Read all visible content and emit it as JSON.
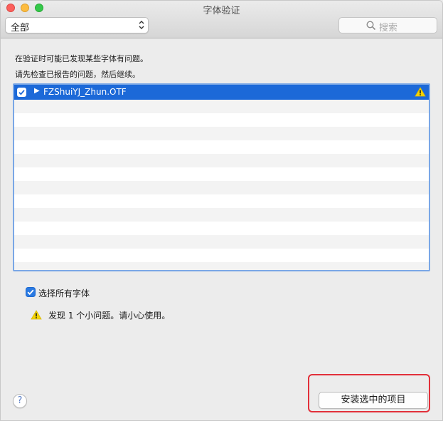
{
  "window": {
    "title": "字体验证"
  },
  "filter": {
    "selected": "全部",
    "arrows_icon": "chevron-up-down-icon"
  },
  "search": {
    "placeholder": "搜索",
    "icon": "search-icon"
  },
  "description": {
    "line1": "在验证时可能已发现某些字体有问题。",
    "line2": "请先检查已报告的问题，然后继续。"
  },
  "font_list": {
    "items": [
      {
        "name": "FZShuiYJ_Zhun.OTF",
        "checked": true,
        "expand_icon": "disclosure-triangle-icon",
        "status_icon": "warning-icon"
      }
    ]
  },
  "select_all": {
    "label": "选择所有字体",
    "checked": true
  },
  "status": {
    "text": "发现 1 个小问题。请小心使用。",
    "icon": "warning-icon"
  },
  "help": {
    "label": "?"
  },
  "actions": {
    "install_label": "安装选中的项目"
  },
  "colors": {
    "selection": "#1c69d8",
    "list_border": "#7aa7e6",
    "warning": "#f5d400",
    "highlight": "#e2303a"
  }
}
